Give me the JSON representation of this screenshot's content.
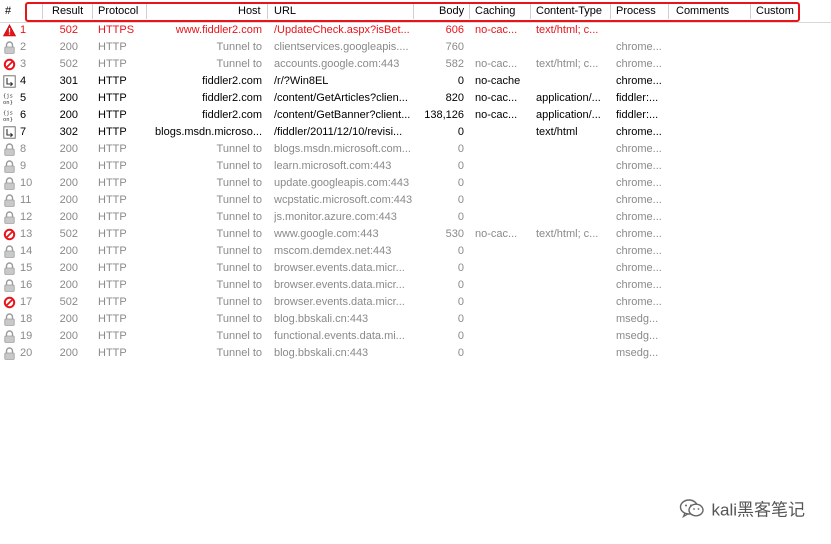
{
  "columns": {
    "hash": "#",
    "result": "Result",
    "protocol": "Protocol",
    "host": "Host",
    "url": "URL",
    "body": "Body",
    "caching": "Caching",
    "content_type": "Content-Type",
    "process": "Process",
    "comments": "Comments",
    "custom": "Custom"
  },
  "sessions": [
    {
      "num": "1",
      "result": "502",
      "protocol": "HTTPS",
      "host": "www.fiddler2.com",
      "url": "/UpdateCheck.aspx?isBet...",
      "body": "606",
      "caching": "no-cac...",
      "content_type": "text/html; c...",
      "process": "",
      "icon": "warning",
      "style": "red"
    },
    {
      "num": "2",
      "result": "200",
      "protocol": "HTTP",
      "host": "Tunnel to",
      "url": "clientservices.googleapis....",
      "body": "760",
      "caching": "",
      "content_type": "",
      "process": "chrome...",
      "icon": "lock",
      "style": "gray"
    },
    {
      "num": "3",
      "result": "502",
      "protocol": "HTTP",
      "host": "Tunnel to",
      "url": "accounts.google.com:443",
      "body": "582",
      "caching": "no-cac...",
      "content_type": "text/html; c...",
      "process": "chrome...",
      "icon": "blocked",
      "style": "gray"
    },
    {
      "num": "4",
      "result": "301",
      "protocol": "HTTP",
      "host": "fiddler2.com",
      "url": "/r/?Win8EL",
      "body": "0",
      "caching": "no-cache",
      "content_type": "",
      "process": "chrome...",
      "icon": "redirect",
      "style": "black"
    },
    {
      "num": "5",
      "result": "200",
      "protocol": "HTTP",
      "host": "fiddler2.com",
      "url": "/content/GetArticles?clien...",
      "body": "820",
      "caching": "no-cac...",
      "content_type": "application/...",
      "process": "fiddler:...",
      "icon": "json",
      "style": "black"
    },
    {
      "num": "6",
      "result": "200",
      "protocol": "HTTP",
      "host": "fiddler2.com",
      "url": "/content/GetBanner?client...",
      "body": "138,126",
      "caching": "no-cac...",
      "content_type": "application/...",
      "process": "fiddler:...",
      "icon": "json",
      "style": "black"
    },
    {
      "num": "7",
      "result": "302",
      "protocol": "HTTP",
      "host": "blogs.msdn.microso...",
      "url": "/fiddler/2011/12/10/revisi...",
      "body": "0",
      "caching": "",
      "content_type": "text/html",
      "process": "chrome...",
      "icon": "redirect",
      "style": "black"
    },
    {
      "num": "8",
      "result": "200",
      "protocol": "HTTP",
      "host": "Tunnel to",
      "url": "blogs.msdn.microsoft.com...",
      "body": "0",
      "caching": "",
      "content_type": "",
      "process": "chrome...",
      "icon": "lock",
      "style": "gray"
    },
    {
      "num": "9",
      "result": "200",
      "protocol": "HTTP",
      "host": "Tunnel to",
      "url": "learn.microsoft.com:443",
      "body": "0",
      "caching": "",
      "content_type": "",
      "process": "chrome...",
      "icon": "lock",
      "style": "gray"
    },
    {
      "num": "10",
      "result": "200",
      "protocol": "HTTP",
      "host": "Tunnel to",
      "url": "update.googleapis.com:443",
      "body": "0",
      "caching": "",
      "content_type": "",
      "process": "chrome...",
      "icon": "lock",
      "style": "gray"
    },
    {
      "num": "11",
      "result": "200",
      "protocol": "HTTP",
      "host": "Tunnel to",
      "url": "wcpstatic.microsoft.com:443",
      "body": "0",
      "caching": "",
      "content_type": "",
      "process": "chrome...",
      "icon": "lock",
      "style": "gray"
    },
    {
      "num": "12",
      "result": "200",
      "protocol": "HTTP",
      "host": "Tunnel to",
      "url": "js.monitor.azure.com:443",
      "body": "0",
      "caching": "",
      "content_type": "",
      "process": "chrome...",
      "icon": "lock",
      "style": "gray"
    },
    {
      "num": "13",
      "result": "502",
      "protocol": "HTTP",
      "host": "Tunnel to",
      "url": "www.google.com:443",
      "body": "530",
      "caching": "no-cac...",
      "content_type": "text/html; c...",
      "process": "chrome...",
      "icon": "blocked",
      "style": "gray"
    },
    {
      "num": "14",
      "result": "200",
      "protocol": "HTTP",
      "host": "Tunnel to",
      "url": "mscom.demdex.net:443",
      "body": "0",
      "caching": "",
      "content_type": "",
      "process": "chrome...",
      "icon": "lock",
      "style": "gray"
    },
    {
      "num": "15",
      "result": "200",
      "protocol": "HTTP",
      "host": "Tunnel to",
      "url": "browser.events.data.micr...",
      "body": "0",
      "caching": "",
      "content_type": "",
      "process": "chrome...",
      "icon": "lock",
      "style": "gray"
    },
    {
      "num": "16",
      "result": "200",
      "protocol": "HTTP",
      "host": "Tunnel to",
      "url": "browser.events.data.micr...",
      "body": "0",
      "caching": "",
      "content_type": "",
      "process": "chrome...",
      "icon": "lock",
      "style": "gray"
    },
    {
      "num": "17",
      "result": "502",
      "protocol": "HTTP",
      "host": "Tunnel to",
      "url": "browser.events.data.micr...",
      "body": "0",
      "caching": "",
      "content_type": "",
      "process": "chrome...",
      "icon": "blocked",
      "style": "gray"
    },
    {
      "num": "18",
      "result": "200",
      "protocol": "HTTP",
      "host": "Tunnel to",
      "url": "blog.bbskali.cn:443",
      "body": "0",
      "caching": "",
      "content_type": "",
      "process": "msedg...",
      "icon": "lock",
      "style": "gray"
    },
    {
      "num": "19",
      "result": "200",
      "protocol": "HTTP",
      "host": "Tunnel to",
      "url": "functional.events.data.mi...",
      "body": "0",
      "caching": "",
      "content_type": "",
      "process": "msedg...",
      "icon": "lock",
      "style": "gray"
    },
    {
      "num": "20",
      "result": "200",
      "protocol": "HTTP",
      "host": "Tunnel to",
      "url": "blog.bbskali.cn:443",
      "body": "0",
      "caching": "",
      "content_type": "",
      "process": "msedg...",
      "icon": "lock",
      "style": "gray"
    }
  ],
  "watermark": {
    "text": "kali黑客笔记",
    "icon": "wechat-icon"
  },
  "colors": {
    "error_red": "#e8141a",
    "tunnel_gray": "#8a8a8a",
    "highlight_box": "#e8141a"
  }
}
